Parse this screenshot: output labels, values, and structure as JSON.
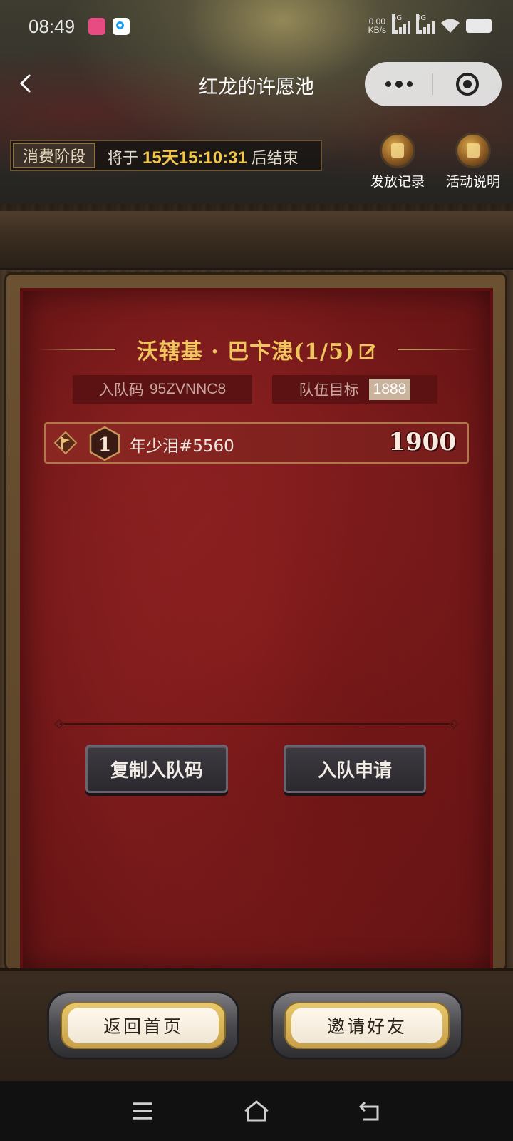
{
  "status_bar": {
    "time": "08:49",
    "net_speed_value": "0.00",
    "net_speed_unit": "KB/s",
    "signal_1_label": "5G",
    "signal_2_label": "5G"
  },
  "nav": {
    "title": "红龙的许愿池"
  },
  "phase": {
    "tag": "消费阶段",
    "prefix": "将于",
    "countdown": "15天15:10:31",
    "suffix": "后结束"
  },
  "top_links": {
    "records": "发放记录",
    "rules": "活动说明"
  },
  "team": {
    "title": "沃辖基 · 巴卞漶(1/5)",
    "code_label": "入队码",
    "code_value": "95ZVNNC8",
    "goal_label": "队伍目标",
    "goal_value": "1888"
  },
  "members": [
    {
      "rank": "1",
      "name": "年少泪#5560",
      "score": "1900"
    }
  ],
  "actions": {
    "copy_code": "复制入队码",
    "apply": "入队申请"
  },
  "bottom": {
    "home": "返回首页",
    "invite": "邀请好友"
  },
  "colors": {
    "panel_red": "#7a1a1b",
    "countdown_gold": "#f2c54b",
    "title_gold": "#f0c45e"
  }
}
